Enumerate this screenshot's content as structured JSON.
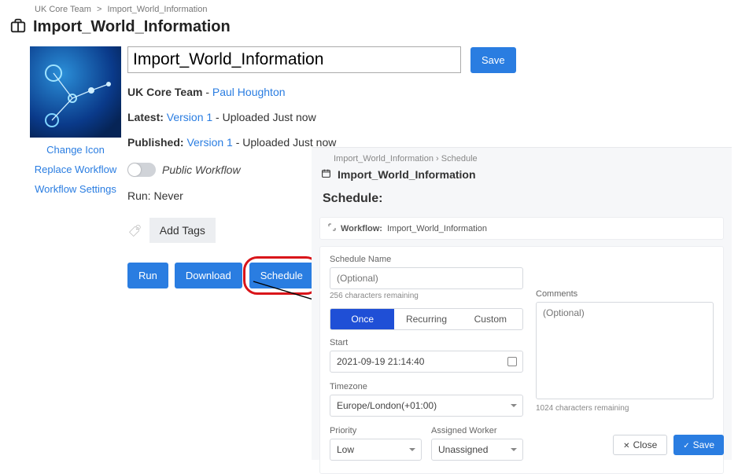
{
  "breadcrumb": {
    "parent": "UK Core Team",
    "current": "Import_World_Information"
  },
  "page_title": "Import_World_Information",
  "workflow_name": "Import_World_Information",
  "save_btn": "Save",
  "owner": {
    "team_label": "UK Core Team",
    "separator": " - ",
    "author": "Paul Houghton"
  },
  "latest": {
    "label": "Latest:",
    "version": "Version 1",
    "suffix": " - Uploaded Just now"
  },
  "published": {
    "label": "Published:",
    "version": "Version 1",
    "suffix": " - Uploaded Just now"
  },
  "public_toggle_label": "Public Workflow",
  "run_label": "Run:",
  "run_value": "Never",
  "add_tags": "Add Tags",
  "left_links": {
    "change_icon": "Change Icon",
    "replace": "Replace Workflow",
    "settings": "Workflow Settings"
  },
  "actions": {
    "run": "Run",
    "download": "Download",
    "schedule": "Schedule"
  },
  "panel": {
    "crumb_parent": "Import_World_Information",
    "crumb_current": "Schedule",
    "title": "Import_World_Information",
    "subtitle": "Schedule:",
    "workflow_label": "Workflow:",
    "workflow_value": "Import_World_Information",
    "schedule_name_label": "Schedule Name",
    "schedule_name_placeholder": "(Optional)",
    "schedule_name_hint": "256 characters remaining",
    "tabs": {
      "once": "Once",
      "recurring": "Recurring",
      "custom": "Custom"
    },
    "start_label": "Start",
    "start_value": "2021-09-19 21:14:40",
    "timezone_label": "Timezone",
    "timezone_value": "Europe/London(+01:00)",
    "priority_label": "Priority",
    "priority_value": "Low",
    "worker_label": "Assigned Worker",
    "worker_value": "Unassigned",
    "comments_label": "Comments",
    "comments_placeholder": "(Optional)",
    "comments_hint": "1024 characters remaining",
    "close_btn": "Close",
    "save_btn": "Save"
  }
}
